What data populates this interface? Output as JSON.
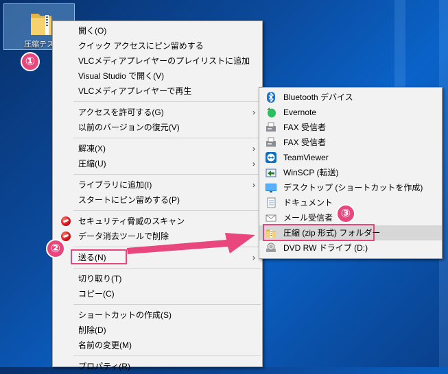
{
  "desktop": {
    "folder_label": "圧縮テス",
    "folder_icon": "folder-zip-icon"
  },
  "callouts": {
    "one": "①",
    "two": "②",
    "three": "③"
  },
  "context_menu": {
    "group1": [
      "開く(O)",
      "クイック アクセスにピン留めする",
      "VLCメディアプレイヤーのプレイリストに追加",
      "Visual Studio で開く(V)",
      "VLCメディアプレイヤーで再生"
    ],
    "group2": [
      "アクセスを許可する(G)",
      "以前のバージョンの復元(V)"
    ],
    "group3": [
      "解凍(X)",
      "圧縮(U)"
    ],
    "group4": [
      "ライブラリに追加(I)",
      "スタートにピン留めする(P)"
    ],
    "group5": [
      "セキュリティ脅威のスキャン",
      "データ消去ツールで削除"
    ],
    "send_to": "送る(N)",
    "group6": [
      "切り取り(T)",
      "コピー(C)"
    ],
    "group7": [
      "ショートカットの作成(S)",
      "削除(D)",
      "名前の変更(M)"
    ],
    "group8": [
      "プロパティ(R)"
    ],
    "submenu_arrow": "›"
  },
  "send_to_menu": {
    "items": [
      {
        "label": "Bluetooth デバイス",
        "icon": "bluetooth-icon"
      },
      {
        "label": "Evernote",
        "icon": "evernote-icon"
      },
      {
        "label": "FAX 受信者",
        "icon": "fax-icon"
      },
      {
        "label": "FAX 受信者",
        "icon": "fax-icon"
      },
      {
        "label": "TeamViewer",
        "icon": "teamviewer-icon"
      },
      {
        "label": "WinSCP (転送)",
        "icon": "winscp-icon"
      },
      {
        "label": "デスクトップ (ショートカットを作成)",
        "icon": "desktop-icon"
      },
      {
        "label": "ドキュメント",
        "icon": "documents-icon"
      },
      {
        "label": "メール受信者",
        "icon": "mail-icon"
      },
      {
        "label": "圧縮 (zip 形式) フォルダー",
        "icon": "zip-folder-icon"
      },
      {
        "label": "DVD RW ドライブ (D:)",
        "icon": "dvd-drive-icon"
      }
    ]
  },
  "colors": {
    "accent": "#e8467c",
    "menu_bg": "#f2f2f2",
    "highlight": "#d7d7d7"
  }
}
